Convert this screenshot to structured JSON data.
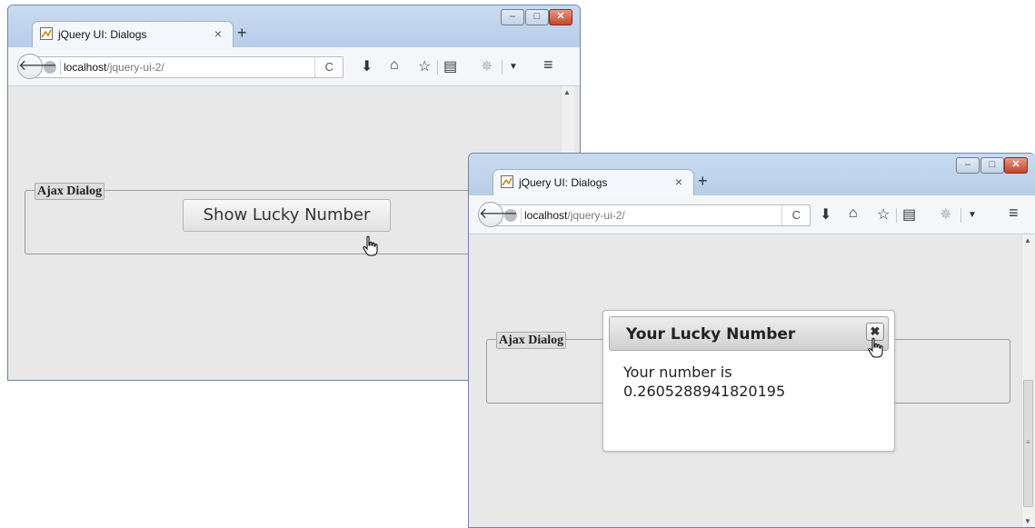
{
  "browser": {
    "tab_title": "jQuery UI: Dialogs",
    "tab_close": "×",
    "new_tab": "+",
    "url_host": "localhost",
    "url_path": "/jquery-ui-2/",
    "reload": "C",
    "caption": {
      "minimize": "–",
      "maximize": "□",
      "close": "✕"
    }
  },
  "page": {
    "legend": "Ajax Dialog",
    "button_label": "Show Lucky Number"
  },
  "dialog": {
    "title": "Your Lucky Number",
    "close_label": "✖",
    "body_label": "Your number is",
    "number": "0.2605288941820195"
  },
  "icons": {
    "back": "arrow-left-icon",
    "globe": "globe-icon",
    "reload": "reload-icon",
    "download": "download-icon",
    "home": "home-icon",
    "bookmark": "star-icon",
    "reading_list": "clipboard-icon",
    "extension": "extension-icon",
    "menu": "hamburger-menu-icon"
  },
  "colors": {
    "page_bg": "#e8e8e8",
    "frame": "#dfe9f5",
    "close_button": "#c6432b"
  }
}
